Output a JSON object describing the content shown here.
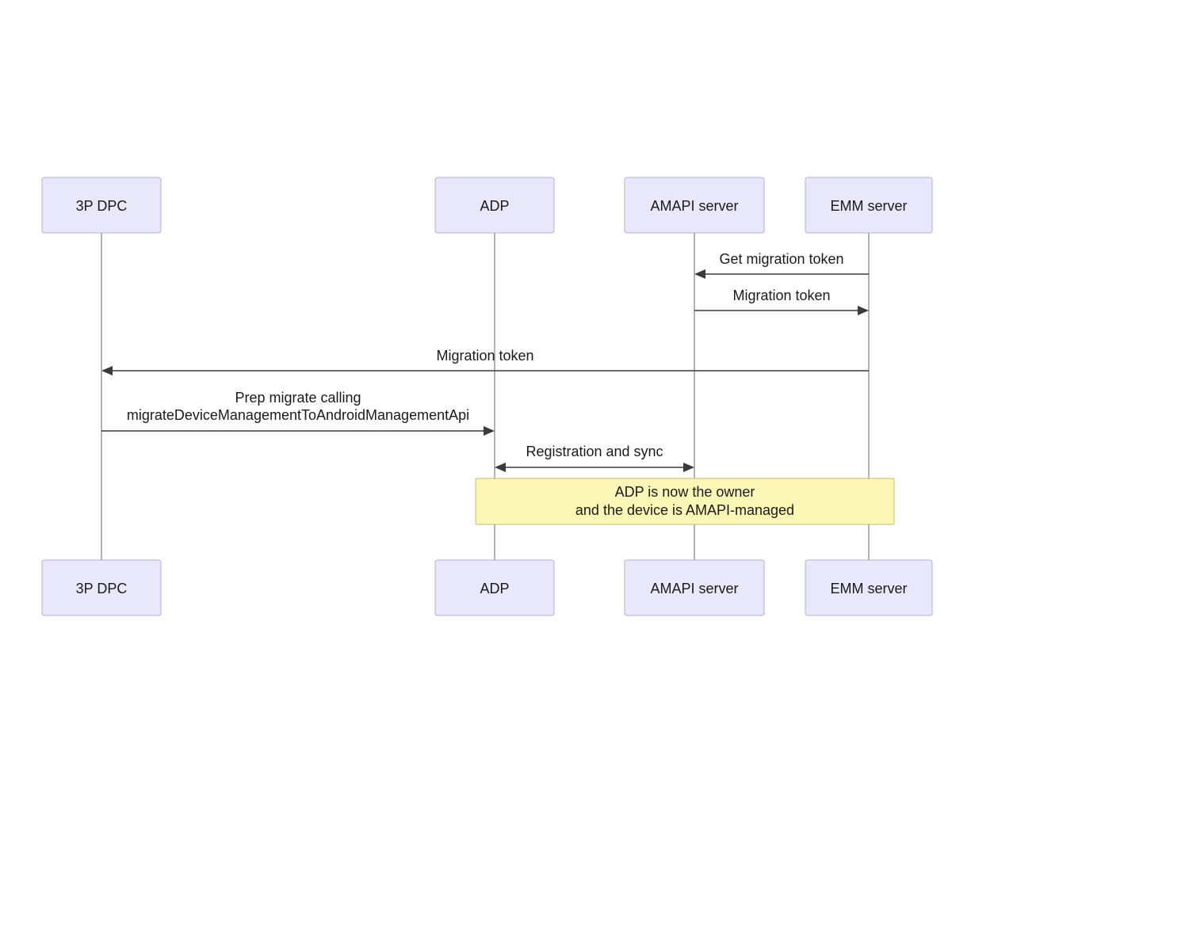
{
  "actors": {
    "dpc": "3P DPC",
    "adp": "ADP",
    "amapi": "AMAPI server",
    "emm": "EMM server"
  },
  "messages": {
    "get_token": "Get migration token",
    "token_back": "Migration token",
    "token_to_dpc": "Migration token",
    "prep1": "Prep migrate calling",
    "prep2": "migrateDeviceManagementToAndroidManagementApi",
    "reg_sync": "Registration and sync"
  },
  "note": {
    "line1": "ADP is now the owner",
    "line2": "and the device is AMAPI-managed"
  }
}
